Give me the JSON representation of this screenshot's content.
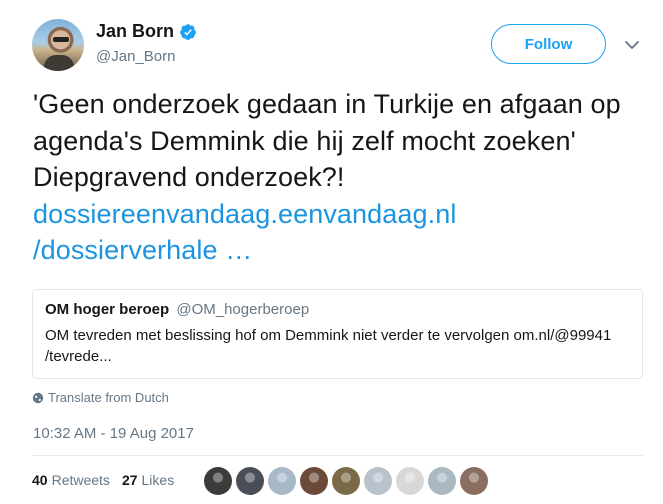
{
  "author": {
    "name": "Jan Born",
    "handle": "@Jan_Born",
    "verified": true
  },
  "follow_label": "Follow",
  "tweet": {
    "text": "'Geen onderzoek gedaan in Turkije en afgaan op agenda's Demmink die hij zelf mocht zoeken' Diepgravend onderzoek?!",
    "link_line1": "dossiereenvandaag.eenvandaag.nl",
    "link_line2": "/dossierverhale  …"
  },
  "quoted_tweet": {
    "name": "OM hoger beroep",
    "handle": "@OM_hogerberoep",
    "text": "OM tevreden met beslissing hof om Demmink niet verder te vervolgen om.nl/@99941 /tevrede..."
  },
  "translate_label": "Translate from Dutch",
  "timestamp": "10:32 AM - 19 Aug 2017",
  "stats": {
    "retweets_count": "40",
    "retweets_label": "Retweets",
    "likes_count": "27",
    "likes_label": "Likes"
  },
  "likers": [
    {
      "name": "liker-avatar-1",
      "color": "#3b3b3b"
    },
    {
      "name": "liker-avatar-2",
      "color": "#4a4f57"
    },
    {
      "name": "liker-avatar-3",
      "color": "#a7b8c9"
    },
    {
      "name": "liker-avatar-4",
      "color": "#6b4a3a"
    },
    {
      "name": "liker-avatar-5",
      "color": "#7a6a45"
    },
    {
      "name": "liker-avatar-6",
      "color": "#b8c2cc"
    },
    {
      "name": "liker-avatar-7",
      "color": "#d8d8d8"
    },
    {
      "name": "liker-avatar-8",
      "color": "#aab8c2"
    },
    {
      "name": "liker-avatar-9",
      "color": "#8a6f60"
    }
  ],
  "colors": {
    "brand_blue": "#1da1f2",
    "link_blue": "#1b95e0",
    "muted_gray": "#657786"
  }
}
